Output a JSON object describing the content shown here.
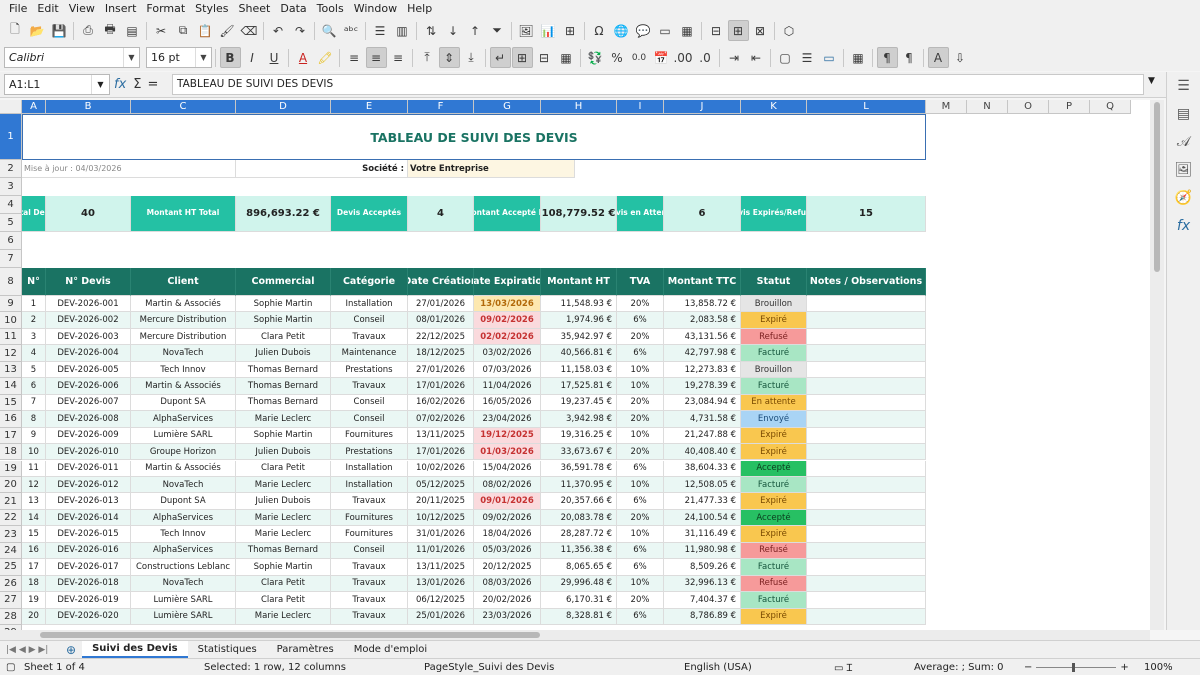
{
  "menu": [
    "File",
    "Edit",
    "View",
    "Insert",
    "Format",
    "Styles",
    "Sheet",
    "Data",
    "Tools",
    "Window",
    "Help"
  ],
  "toolbar": {
    "font_name": "Calibri",
    "font_size": "16 pt",
    "bold": "B",
    "italic": "I",
    "underline": "U",
    "percent": "%",
    "decimals": "0.0",
    "fx": "fx",
    "sigma": "Σ",
    "equals": "="
  },
  "formula_bar": {
    "name_box": "A1:L1",
    "content": "TABLEAU DE SUIVI DES DEVIS"
  },
  "columns": [
    "A",
    "B",
    "C",
    "D",
    "E",
    "F",
    "G",
    "H",
    "I",
    "J",
    "K",
    "L",
    "M",
    "N",
    "O",
    "P",
    "Q"
  ],
  "row_numbers": [
    "1",
    "2",
    "3",
    "4",
    "5",
    "6",
    "7",
    "8",
    "9",
    "10",
    "11",
    "12",
    "13",
    "14",
    "15",
    "16",
    "17",
    "18",
    "19",
    "20",
    "21",
    "22",
    "23",
    "24",
    "25",
    "26",
    "27",
    "28",
    "29"
  ],
  "title": "TABLEAU DE SUIVI DES DEVIS",
  "update_date": "Mise à jour : 04/03/2026",
  "company_label": "Société :",
  "company_name": "Votre Entreprise",
  "summary": {
    "total_label": "Total Devis",
    "total_value": "40",
    "montant_label": "Montant HT Total",
    "montant_value": "896,693.22 €",
    "accepted_label": "Devis Acceptés",
    "accepted_value": "4",
    "accepted_amount_label": "Montant Accepté HT",
    "accepted_amount_value": "108,779.52 €",
    "pending_label": "Devis en Attente",
    "pending_value": "6",
    "expired_label": "Devis Expirés/Refusés",
    "expired_value": "15"
  },
  "headers": [
    "N°",
    "N° Devis",
    "Client",
    "Commercial",
    "Catégorie",
    "Date Création",
    "Date Expiration",
    "Montant HT",
    "TVA",
    "Montant TTC",
    "Statut",
    "Notes / Observations"
  ],
  "rows": [
    [
      "1",
      "DEV-2026-001",
      "Martin & Associés",
      "Sophie Martin",
      "Installation",
      "27/01/2026",
      "13/03/2026",
      "11,548.93 €",
      "20%",
      "13,858.72 €",
      "Brouillon",
      ""
    ],
    [
      "2",
      "DEV-2026-002",
      "Mercure Distribution",
      "Sophie Martin",
      "Conseil",
      "08/01/2026",
      "09/02/2026",
      "1,974.96 €",
      "6%",
      "2,083.58 €",
      "Expiré",
      ""
    ],
    [
      "3",
      "DEV-2026-003",
      "Mercure Distribution",
      "Clara Petit",
      "Travaux",
      "22/12/2025",
      "02/02/2026",
      "35,942.97 €",
      "20%",
      "43,131.56 €",
      "Refusé",
      ""
    ],
    [
      "4",
      "DEV-2026-004",
      "NovaTech",
      "Julien Dubois",
      "Maintenance",
      "18/12/2025",
      "03/02/2026",
      "40,566.81 €",
      "6%",
      "42,797.98 €",
      "Facturé",
      ""
    ],
    [
      "5",
      "DEV-2026-005",
      "Tech Innov",
      "Thomas Bernard",
      "Prestations",
      "27/01/2026",
      "07/03/2026",
      "11,158.03 €",
      "10%",
      "12,273.83 €",
      "Brouillon",
      ""
    ],
    [
      "6",
      "DEV-2026-006",
      "Martin & Associés",
      "Thomas Bernard",
      "Travaux",
      "17/01/2026",
      "11/04/2026",
      "17,525.81 €",
      "10%",
      "19,278.39 €",
      "Facturé",
      ""
    ],
    [
      "7",
      "DEV-2026-007",
      "Dupont SA",
      "Thomas Bernard",
      "Conseil",
      "16/02/2026",
      "16/05/2026",
      "19,237.45 €",
      "20%",
      "23,084.94 €",
      "En attente",
      ""
    ],
    [
      "8",
      "DEV-2026-008",
      "AlphaServices",
      "Marie Leclerc",
      "Conseil",
      "07/02/2026",
      "23/04/2026",
      "3,942.98 €",
      "20%",
      "4,731.58 €",
      "Envoyé",
      ""
    ],
    [
      "9",
      "DEV-2026-009",
      "Lumière SARL",
      "Sophie Martin",
      "Fournitures",
      "13/11/2025",
      "19/12/2025",
      "19,316.25 €",
      "10%",
      "21,247.88 €",
      "Expiré",
      ""
    ],
    [
      "10",
      "DEV-2026-010",
      "Groupe Horizon",
      "Julien Dubois",
      "Prestations",
      "17/01/2026",
      "01/03/2026",
      "33,673.67 €",
      "20%",
      "40,408.40 €",
      "Expiré",
      ""
    ],
    [
      "11",
      "DEV-2026-011",
      "Martin & Associés",
      "Clara Petit",
      "Installation",
      "10/02/2026",
      "15/04/2026",
      "36,591.78 €",
      "6%",
      "38,604.33 €",
      "Accepté",
      ""
    ],
    [
      "12",
      "DEV-2026-012",
      "NovaTech",
      "Marie Leclerc",
      "Installation",
      "05/12/2025",
      "08/02/2026",
      "11,370.95 €",
      "10%",
      "12,508.05 €",
      "Facturé",
      ""
    ],
    [
      "13",
      "DEV-2026-013",
      "Dupont SA",
      "Julien Dubois",
      "Travaux",
      "20/11/2025",
      "09/01/2026",
      "20,357.66 €",
      "6%",
      "21,477.33 €",
      "Expiré",
      ""
    ],
    [
      "14",
      "DEV-2026-014",
      "AlphaServices",
      "Marie Leclerc",
      "Fournitures",
      "10/12/2025",
      "09/02/2026",
      "20,083.78 €",
      "20%",
      "24,100.54 €",
      "Accepté",
      ""
    ],
    [
      "15",
      "DEV-2026-015",
      "Tech Innov",
      "Marie Leclerc",
      "Fournitures",
      "31/01/2026",
      "18/04/2026",
      "28,287.72 €",
      "10%",
      "31,116.49 €",
      "Expiré",
      ""
    ],
    [
      "16",
      "DEV-2026-016",
      "AlphaServices",
      "Thomas Bernard",
      "Conseil",
      "11/01/2026",
      "05/03/2026",
      "11,356.38 €",
      "6%",
      "11,980.98 €",
      "Refusé",
      ""
    ],
    [
      "17",
      "DEV-2026-017",
      "Constructions Leblanc",
      "Sophie Martin",
      "Travaux",
      "13/11/2025",
      "20/12/2025",
      "8,065.65 €",
      "6%",
      "8,509.26 €",
      "Facturé",
      ""
    ],
    [
      "18",
      "DEV-2026-018",
      "NovaTech",
      "Clara Petit",
      "Travaux",
      "13/01/2026",
      "08/03/2026",
      "29,996.48 €",
      "10%",
      "32,996.13 €",
      "Refusé",
      ""
    ],
    [
      "19",
      "DEV-2026-019",
      "Lumière SARL",
      "Clara Petit",
      "Travaux",
      "06/12/2025",
      "20/02/2026",
      "6,170.31 €",
      "20%",
      "7,404.37 €",
      "Facturé",
      ""
    ],
    [
      "20",
      "DEV-2026-020",
      "Lumière SARL",
      "Marie Leclerc",
      "Travaux",
      "25/01/2026",
      "23/03/2026",
      "8,328.81 €",
      "6%",
      "8,786.89 €",
      "Expiré",
      ""
    ]
  ],
  "exp_style": [
    "warn",
    "exp",
    "exp",
    "",
    "",
    "",
    "",
    "",
    "exp",
    "exp",
    "",
    "",
    "exp",
    "",
    "",
    "",
    "",
    "",
    "",
    ""
  ],
  "sheets": [
    "Suivi des Devis",
    "Statistiques",
    "Paramètres",
    "Mode d'emploi"
  ],
  "status": {
    "sheet": "Sheet 1 of 4",
    "selection": "Selected: 1 row, 12 columns",
    "pagestyle": "PageStyle_Suivi des Devis",
    "language": "English (USA)",
    "average": "Average: ; Sum: 0",
    "zoom": "100%"
  }
}
